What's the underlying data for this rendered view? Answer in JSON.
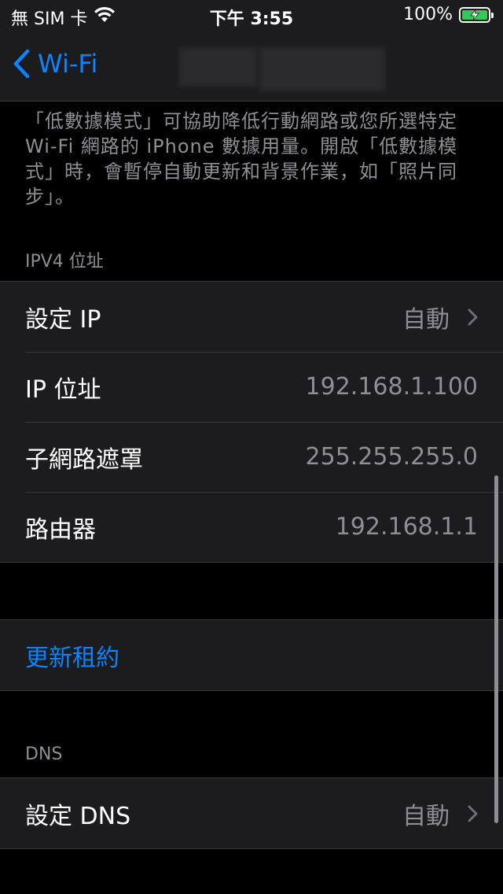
{
  "status_bar": {
    "carrier": "無 SIM 卡",
    "time": "下午 3:55",
    "battery": "100%",
    "battery_color": "#34c759"
  },
  "nav": {
    "back_label": "Wi-Fi",
    "accent": "#0a84ff"
  },
  "description": "「低數據模式」可協助降低行動網路或您所選特定 Wi-Fi 網路的 iPhone 數據用量。開啟「低數據模式」時，會暫停自動更新和背景作業，如「照片同步」。",
  "ipv4": {
    "header": "IPV4 位址",
    "rows": [
      {
        "label": "設定 IP",
        "value": "自動"
      },
      {
        "label": "IP 位址",
        "value": "192.168.1.100"
      },
      {
        "label": "子網路遮罩",
        "value": "255.255.255.0"
      },
      {
        "label": "路由器",
        "value": "192.168.1.1"
      }
    ]
  },
  "renew": {
    "label": "更新租約"
  },
  "dns": {
    "header": "DNS",
    "rows": [
      {
        "label": "設定 DNS",
        "value": "自動"
      }
    ]
  }
}
